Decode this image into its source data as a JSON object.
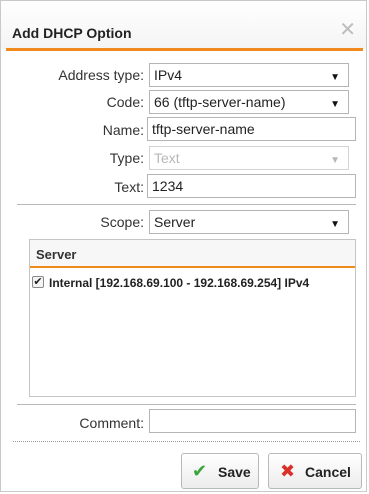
{
  "dialog": {
    "title": "Add DHCP Option",
    "close_glyph": "✕"
  },
  "form": {
    "address_type": {
      "label": "Address type:",
      "value": "IPv4"
    },
    "code": {
      "label": "Code:",
      "value": "66 (tftp-server-name)"
    },
    "name": {
      "label": "Name:",
      "value": "tftp-server-name"
    },
    "type": {
      "label": "Type:",
      "value": "Text",
      "disabled": true
    },
    "text": {
      "label": "Text:",
      "value": "1234"
    },
    "scope": {
      "label": "Scope:",
      "value": "Server"
    },
    "comment": {
      "label": "Comment:",
      "value": ""
    }
  },
  "server_list": {
    "header": "Server",
    "items": [
      {
        "label": "Internal [192.168.69.100 - 192.168.69.254] IPv4",
        "checked": true
      }
    ]
  },
  "buttons": {
    "save": {
      "label": "Save",
      "icon": "check-icon",
      "color": "#3aa53a"
    },
    "cancel": {
      "label": "Cancel",
      "icon": "x-icon",
      "color": "#d9312a"
    }
  },
  "colors": {
    "accent": "#f08a1c"
  }
}
